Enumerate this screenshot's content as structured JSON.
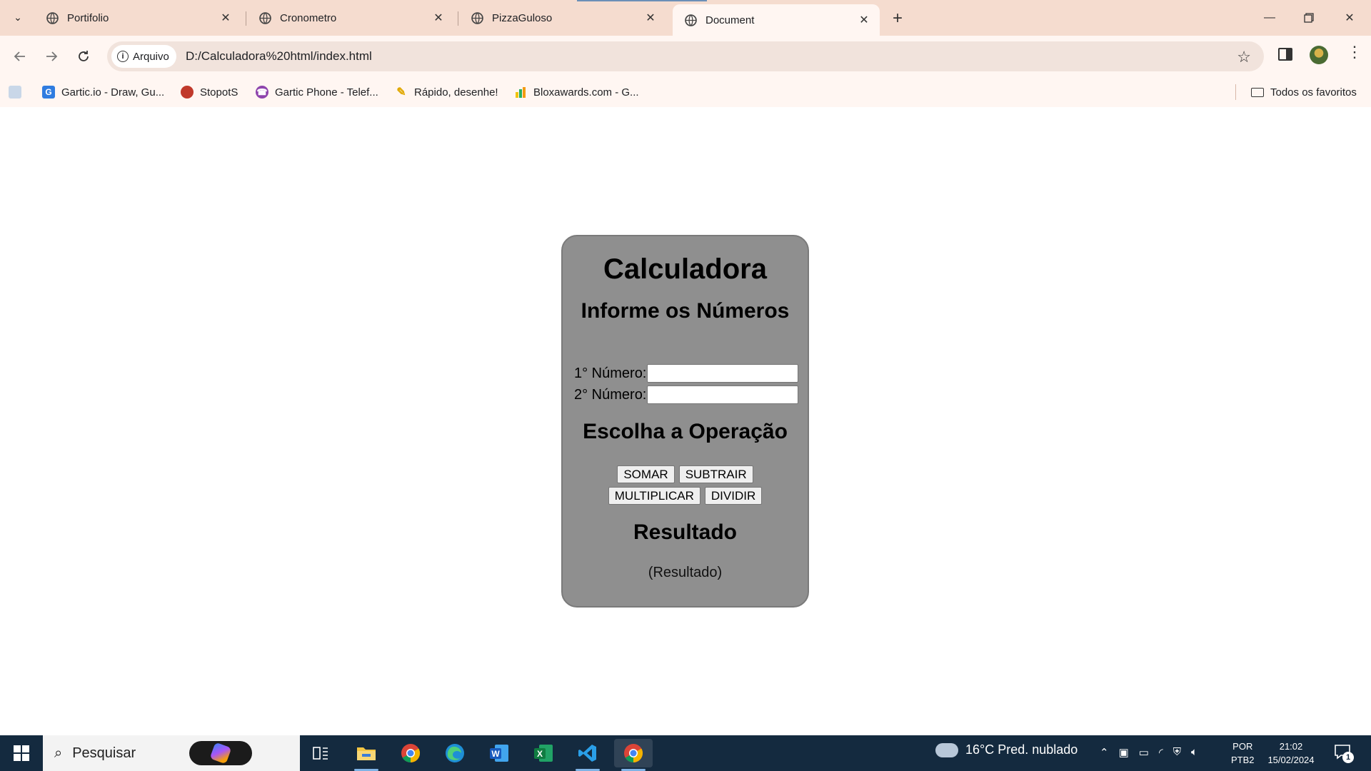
{
  "browser": {
    "tabs": [
      {
        "title": "Portifolio"
      },
      {
        "title": "Cronometro"
      },
      {
        "title": "PizzaGuloso"
      },
      {
        "title": "Document"
      }
    ],
    "security_label": "Arquivo",
    "url": "D:/Calculadora%20html/index.html",
    "bookmarks": [
      {
        "label": "Gartic.io - Draw, Gu..."
      },
      {
        "label": "StopotS"
      },
      {
        "label": "Gartic Phone - Telef..."
      },
      {
        "label": "Rápido, desenhe!"
      },
      {
        "label": "Bloxawards.com - G..."
      }
    ],
    "all_bookmarks_label": "Todos os favoritos"
  },
  "page": {
    "title": "Calculadora",
    "subtitle": "Informe os Números",
    "field1_label": "1° Número:",
    "field1_value": "",
    "field2_label": "2° Número:",
    "field2_value": "",
    "operation_heading": "Escolha a Operação",
    "buttons": {
      "add": "SOMAR",
      "subtract": "SUBTRAIR",
      "multiply": "MULTIPLICAR",
      "divide": "DIVIDIR"
    },
    "result_heading": "Resultado",
    "result_value": "(Resultado)",
    "panel_color": "#8f8f8f"
  },
  "taskbar": {
    "search_placeholder": "Pesquisar",
    "weather": "16°C  Pred. nublado",
    "lang_line1": "POR",
    "lang_line2": "PTB2",
    "time": "21:02",
    "date": "15/02/2024",
    "notification_count": "1",
    "pinned_apps": [
      "task-view",
      "file-explorer",
      "chrome",
      "edge",
      "word",
      "excel",
      "vscode",
      "chrome-active"
    ]
  }
}
